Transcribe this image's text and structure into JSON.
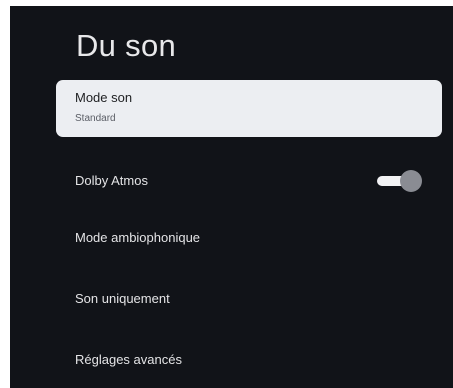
{
  "page": {
    "title": "Du son"
  },
  "menu": {
    "items": [
      {
        "label": "Mode son",
        "value": "Standard"
      },
      {
        "label": "Dolby Atmos",
        "toggle_on": true
      },
      {
        "label": "Mode ambiophonique"
      },
      {
        "label": "Son uniquement"
      },
      {
        "label": "Réglages avancés"
      }
    ]
  },
  "colors": {
    "background": "#111318",
    "focus_background": "#eceef2",
    "text_primary": "#e4e4e6",
    "toggle_track": "#f2f2f4",
    "toggle_knob": "#8a8c93"
  }
}
